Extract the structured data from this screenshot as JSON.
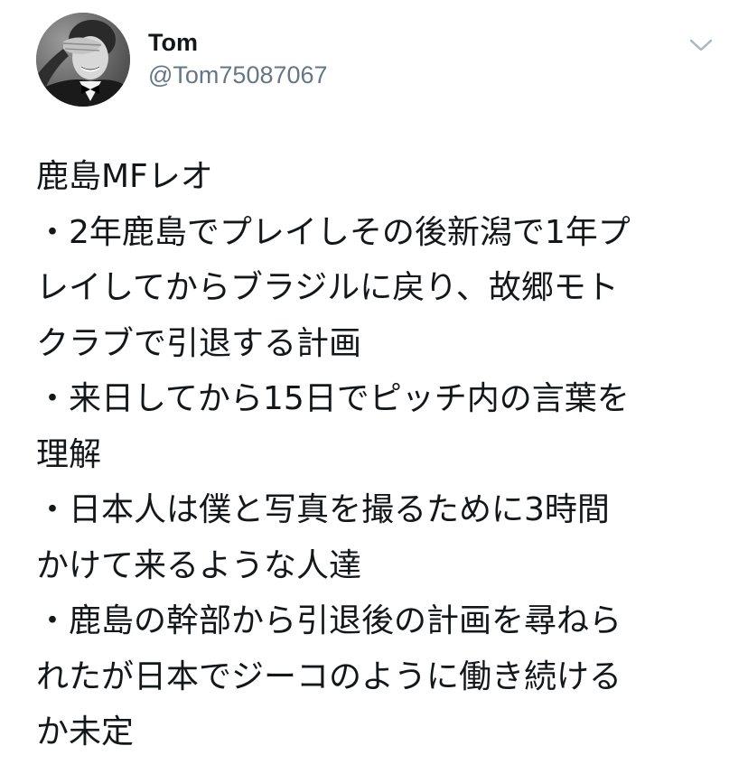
{
  "user": {
    "name": "Tom",
    "handle": "@Tom75087067"
  },
  "icons": {
    "avatar": "profile-photo",
    "menu": "chevron-down-icon"
  },
  "colors": {
    "text": "#14171a",
    "secondary_text": "#657786",
    "caret": "#aab8c2"
  },
  "tweet": {
    "lines": [
      "鹿島MFレオ",
      "・2年鹿島でプレイしその後新潟で1年プ",
      "レイしてからブラジルに戻り、故郷モト",
      "クラブで引退する計画",
      "・来日してから15日でピッチ内の言葉を",
      "理解",
      "・日本人は僕と写真を撮るために3時間",
      "かけて来るような人達",
      "・鹿島の幹部から引退後の計画を尋ねら",
      "れたが日本でジーコのように働き続ける",
      "か未定"
    ]
  }
}
